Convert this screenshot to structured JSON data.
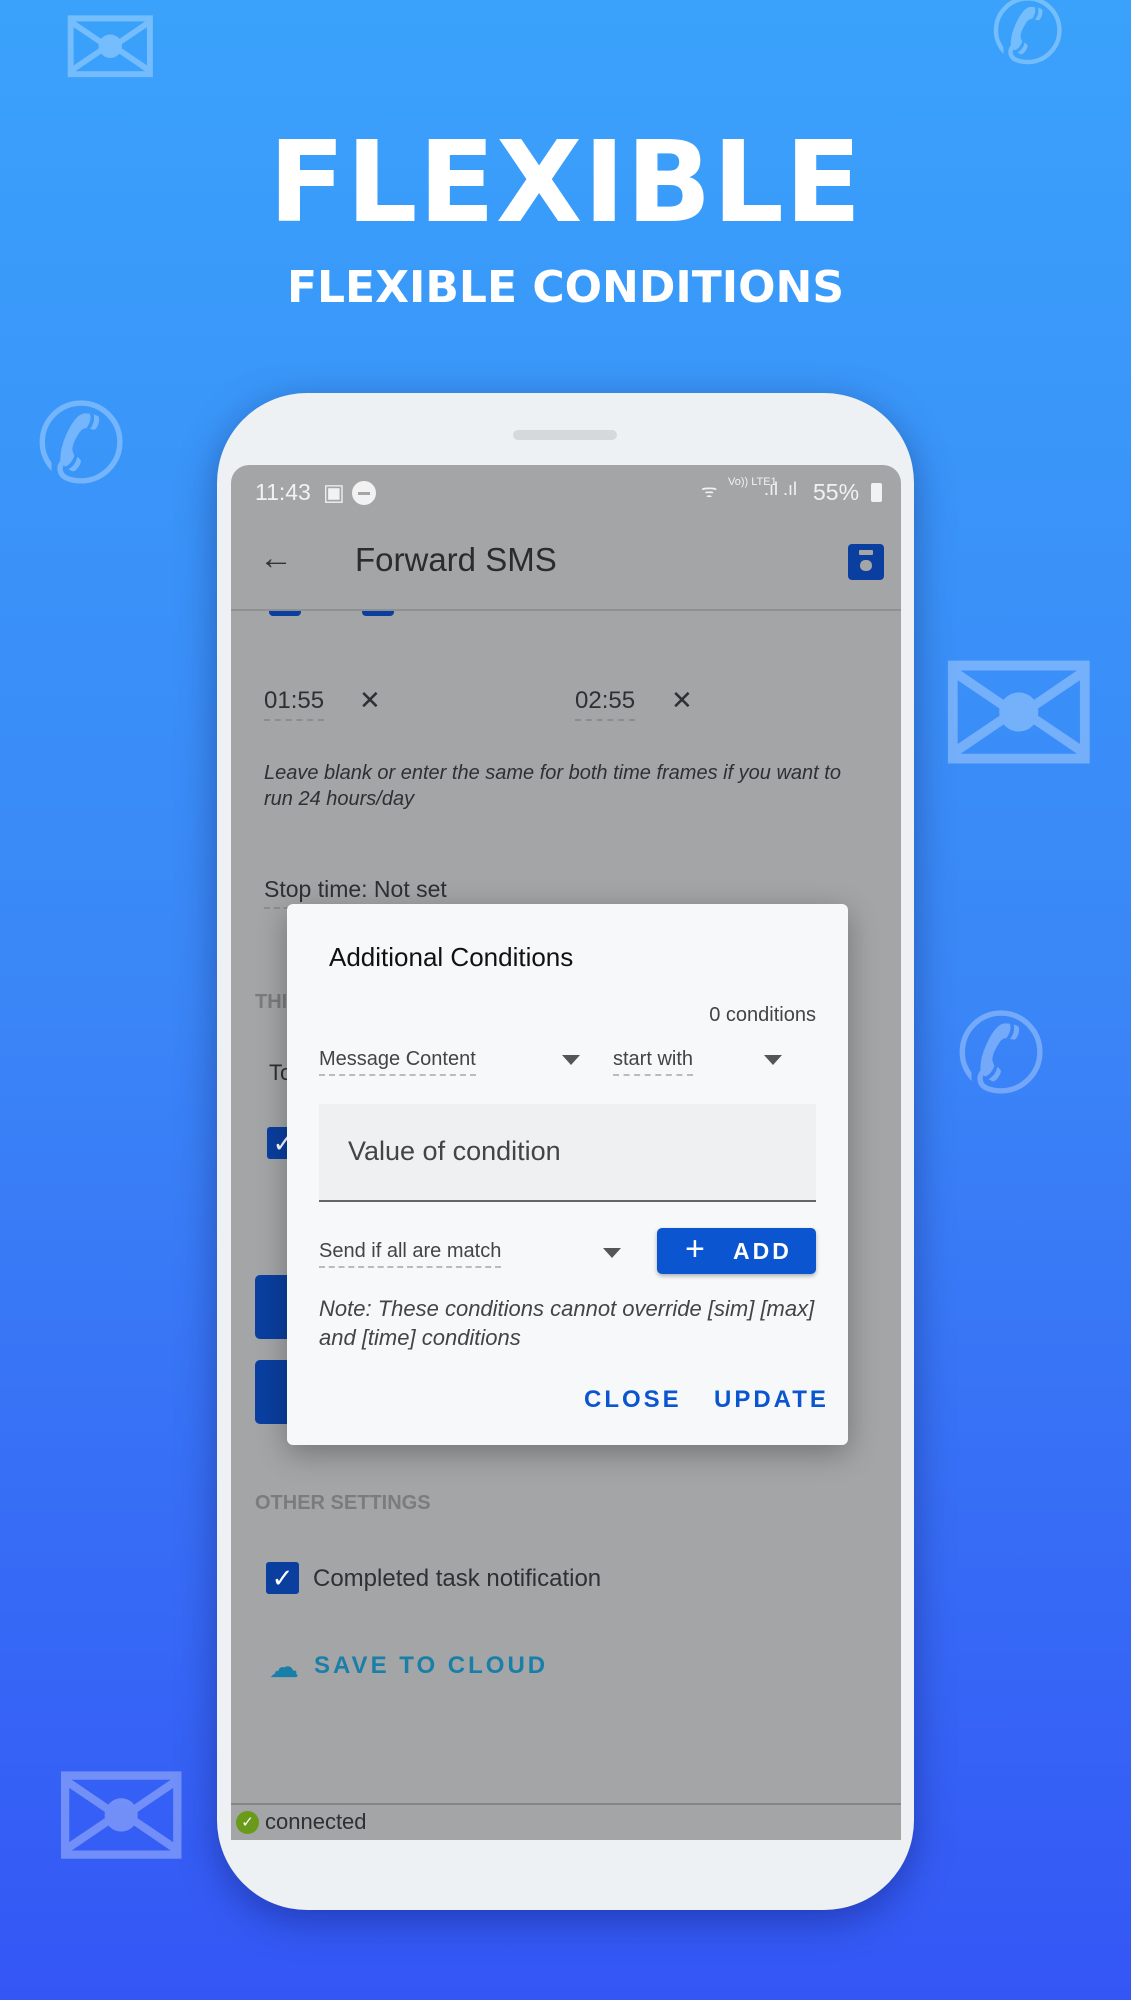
{
  "hero": {
    "title": "FLEXIBLE",
    "subtitle": "FLEXIBLE CONDITIONS"
  },
  "status_bar": {
    "time": "11:43",
    "network": "Vo)) LTE1",
    "battery": "55%"
  },
  "app_bar": {
    "title": "Forward SMS",
    "back_icon": "arrow-left-icon",
    "save_icon": "save-icon"
  },
  "time_frame": {
    "start": "01:55",
    "end": "02:55",
    "clear": "✕",
    "hint": "Leave blank or enter the same for both time frames if you want to run 24 hours/day"
  },
  "stop_time": "Stop time: Not set",
  "section_partial": "THI",
  "to_partial": "To",
  "dialog": {
    "title": "Additional Conditions",
    "count": "0 conditions",
    "field_select": "Message Content",
    "operator_select": "start with",
    "value_placeholder": "Value of condition",
    "match_select": "Send if all are match",
    "add_label": "ADD",
    "note": "Note: These conditions cannot override [sim] [max] and [time] conditions",
    "close_label": "CLOSE",
    "update_label": "UPDATE"
  },
  "other_settings": {
    "header": "OTHER SETTINGS",
    "notification_label": "Completed task notification",
    "notification_checked": true,
    "save_cloud_label": "SAVE TO CLOUD"
  },
  "footer": {
    "status": "connected"
  },
  "colors": {
    "accent": "#0b56d0",
    "checkbox": "#0a3fa0",
    "cloud": "#1a7fa8",
    "connected": "#6a9a1a"
  }
}
